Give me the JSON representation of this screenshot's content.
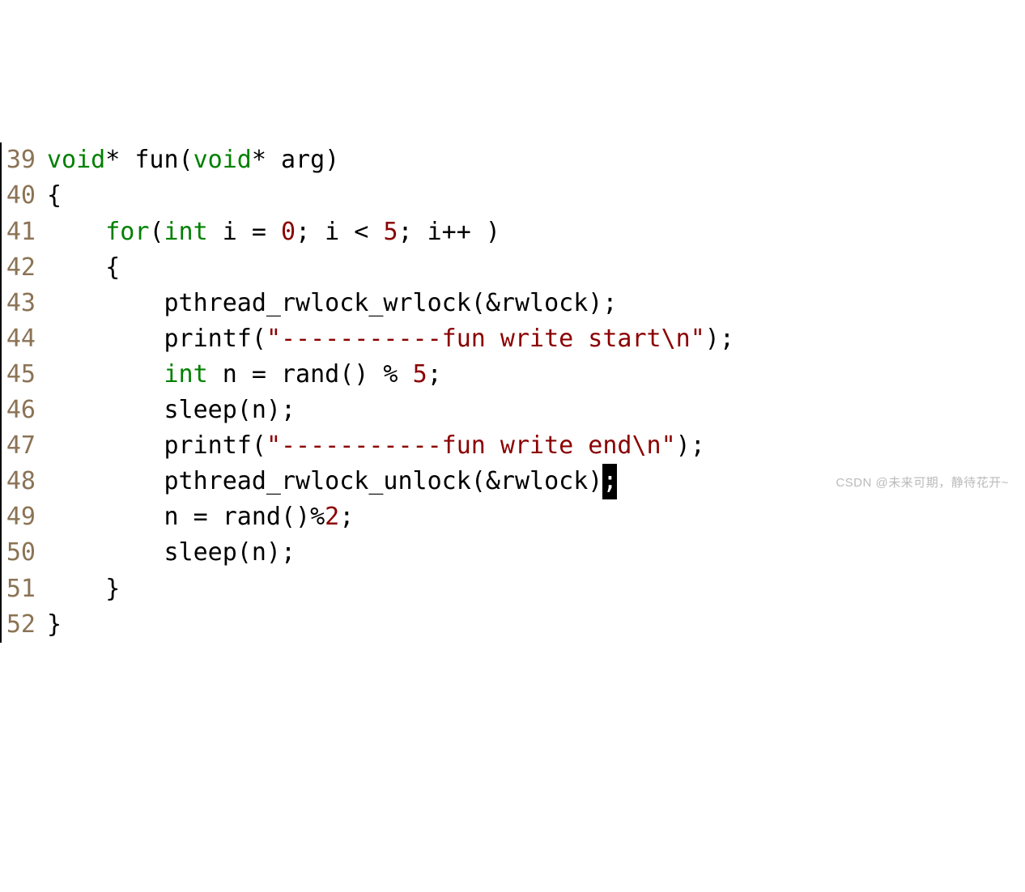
{
  "watermark": "CSDN @未来可期，静待花开~",
  "lines": [
    {
      "num": "39",
      "tokens": [
        {
          "cls": "type",
          "t": "void"
        },
        {
          "cls": "plain",
          "t": "* fun("
        },
        {
          "cls": "type",
          "t": "void"
        },
        {
          "cls": "plain",
          "t": "* arg)"
        }
      ]
    },
    {
      "num": "40",
      "tokens": [
        {
          "cls": "plain",
          "t": "{"
        }
      ]
    },
    {
      "num": "41",
      "tokens": [
        {
          "cls": "plain",
          "t": "    "
        },
        {
          "cls": "kw",
          "t": "for"
        },
        {
          "cls": "plain",
          "t": "("
        },
        {
          "cls": "type",
          "t": "int"
        },
        {
          "cls": "plain",
          "t": " i = "
        },
        {
          "cls": "num",
          "t": "0"
        },
        {
          "cls": "plain",
          "t": "; i < "
        },
        {
          "cls": "num",
          "t": "5"
        },
        {
          "cls": "plain",
          "t": "; i++ )"
        }
      ]
    },
    {
      "num": "42",
      "tokens": [
        {
          "cls": "plain",
          "t": "    {"
        }
      ]
    },
    {
      "num": "43",
      "tokens": [
        {
          "cls": "plain",
          "t": "        pthread_rwlock_wrlock(&rwlock);"
        }
      ]
    },
    {
      "num": "44",
      "tokens": [
        {
          "cls": "plain",
          "t": "        printf("
        },
        {
          "cls": "str",
          "t": "\"-----------fun write start"
        },
        {
          "cls": "esc",
          "t": "\\n"
        },
        {
          "cls": "str",
          "t": "\""
        },
        {
          "cls": "plain",
          "t": ");"
        }
      ]
    },
    {
      "num": "45",
      "tokens": [
        {
          "cls": "plain",
          "t": "        "
        },
        {
          "cls": "type",
          "t": "int"
        },
        {
          "cls": "plain",
          "t": " n = rand() % "
        },
        {
          "cls": "num",
          "t": "5"
        },
        {
          "cls": "plain",
          "t": ";"
        }
      ]
    },
    {
      "num": "46",
      "tokens": [
        {
          "cls": "plain",
          "t": "        sleep(n);"
        }
      ]
    },
    {
      "num": "47",
      "tokens": [
        {
          "cls": "plain",
          "t": "        printf("
        },
        {
          "cls": "str",
          "t": "\"-----------fun write end"
        },
        {
          "cls": "esc",
          "t": "\\n"
        },
        {
          "cls": "str",
          "t": "\""
        },
        {
          "cls": "plain",
          "t": ");"
        }
      ]
    },
    {
      "num": "48",
      "tokens": [
        {
          "cls": "plain",
          "t": "        pthread_rwlock_unlock(&rwlock)"
        },
        {
          "cls": "cursor",
          "t": ";"
        }
      ]
    },
    {
      "num": "49",
      "tokens": [
        {
          "cls": "plain",
          "t": "        n = rand()%"
        },
        {
          "cls": "num",
          "t": "2"
        },
        {
          "cls": "plain",
          "t": ";"
        }
      ]
    },
    {
      "num": "50",
      "tokens": [
        {
          "cls": "plain",
          "t": "        sleep(n);"
        }
      ]
    },
    {
      "num": "51",
      "tokens": [
        {
          "cls": "plain",
          "t": "    }"
        }
      ]
    },
    {
      "num": "52",
      "tokens": [
        {
          "cls": "plain",
          "t": "}"
        }
      ]
    }
  ]
}
